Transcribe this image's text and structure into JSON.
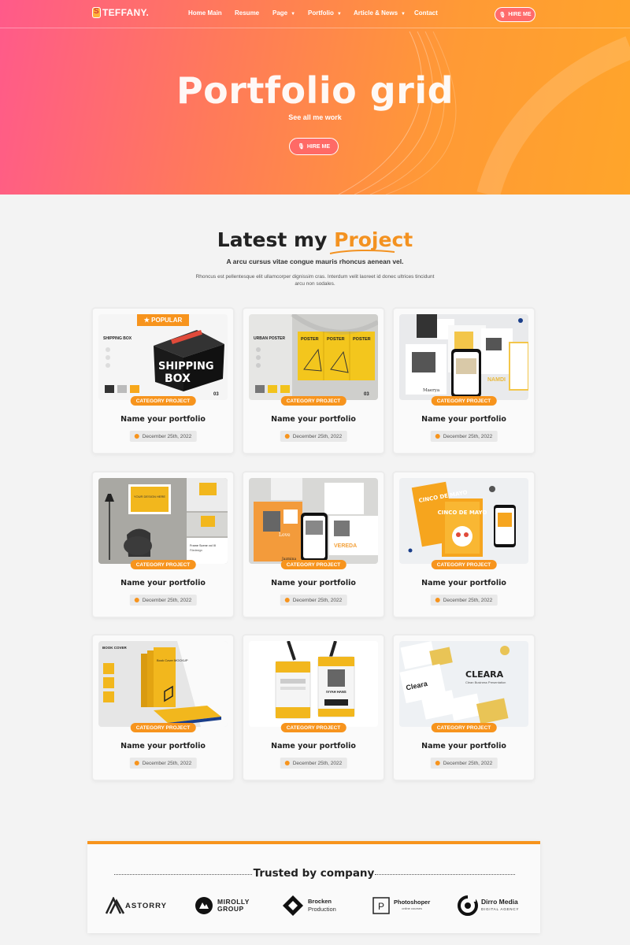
{
  "nav": {
    "brand": "TEFFANY.",
    "items": [
      {
        "label": "Home Main"
      },
      {
        "label": "Resume"
      },
      {
        "label": "Page",
        "caret": "▼"
      },
      {
        "label": "Portfolio",
        "caret": "▼"
      },
      {
        "label": "Article & News",
        "caret": "▼"
      },
      {
        "label": "Contact"
      }
    ],
    "hire_label": "HIRE ME"
  },
  "hero": {
    "title": "Portfolio grid",
    "subtitle": "See all me work",
    "hire_label": "HIRE ME"
  },
  "section": {
    "title_plain": "Latest my",
    "title_accent": "Project",
    "lead": "A arcu cursus vitae congue mauris rhoncus aenean vel.",
    "description": "Rhoncus est pellentesque elit ullamcorper dignissim cras. Interdum velit laoreet id donec ultrices tincidunt arcu non sodales."
  },
  "popular_badge": "★ POPULAR",
  "cards": [
    {
      "category": "CATEGORY PROJECT",
      "name": "Name your portfolio",
      "date": "December 25th, 2022",
      "thumb": {
        "heading": "SHIPPING BOX",
        "big1": "SHIPPING",
        "big2": "BOX",
        "num": "03"
      }
    },
    {
      "category": "CATEGORY PROJECT",
      "name": "Name your portfolio",
      "date": "December 25th, 2022",
      "thumb": {
        "heading": "URBAN POSTER",
        "poster": "POSTER",
        "num": "03"
      }
    },
    {
      "category": "CATEGORY PROJECT",
      "name": "Name your portfolio",
      "date": "December 25th, 2022",
      "thumb": {
        "w1": "Maerya",
        "w2": "NAMDI"
      }
    },
    {
      "category": "CATEGORY PROJECT",
      "name": "Name your portfolio",
      "date": "December 25th, 2022",
      "thumb": {
        "frame": "YOUR DESIGN HERE",
        "label": "Frame Scene vol III",
        "sub": "Filedesign"
      }
    },
    {
      "category": "CATEGORY PROJECT",
      "name": "Name your portfolio",
      "date": "December 25th, 2022",
      "thumb": {
        "w1": "Love",
        "w2": "VEREDA",
        "w3": "Jazmina"
      }
    },
    {
      "category": "CATEGORY PROJECT",
      "name": "Name your portfolio",
      "date": "December 25th, 2022",
      "thumb": {
        "w1": "CINCO DE MAYO",
        "w2": "CINCO DE MAYO"
      }
    },
    {
      "category": "CATEGORY PROJECT",
      "name": "Name your portfolio",
      "date": "December 25th, 2022",
      "thumb": {
        "heading": "BOOK COVER",
        "book": "Book Cover MOCKUP"
      }
    },
    {
      "category": "CATEGORY PROJECT",
      "name": "Name your portfolio",
      "date": "December 25th, 2022",
      "thumb": {
        "name": "IVYAH HANS"
      }
    },
    {
      "category": "CATEGORY PROJECT",
      "name": "Name your portfolio",
      "date": "December 25th, 2022",
      "thumb": {
        "brand": "CLEARA",
        "tag": "Clean Business Presentation",
        "w1": "Cleara"
      }
    }
  ],
  "trusted": {
    "title": "Trusted by company",
    "logos": [
      {
        "name": "ASTORRY",
        "icon": "astorry-logo-icon"
      },
      {
        "name": "MIROLLY",
        "line2": "GROUP",
        "icon": "mirolly-logo-icon"
      },
      {
        "name": "Brocken",
        "line2": "Production",
        "icon": "brocken-logo-icon"
      },
      {
        "name": "Photoshoper",
        "line2": "online courses",
        "icon": "photoshoper-logo-icon"
      },
      {
        "name": "Dirro Media",
        "line2": "DIGITAL AGENCY",
        "icon": "dirro-logo-icon"
      }
    ]
  },
  "colors": {
    "accent": "#f7941d",
    "hero_start": "#ff5a8a",
    "hero_end": "#ffa52a"
  }
}
